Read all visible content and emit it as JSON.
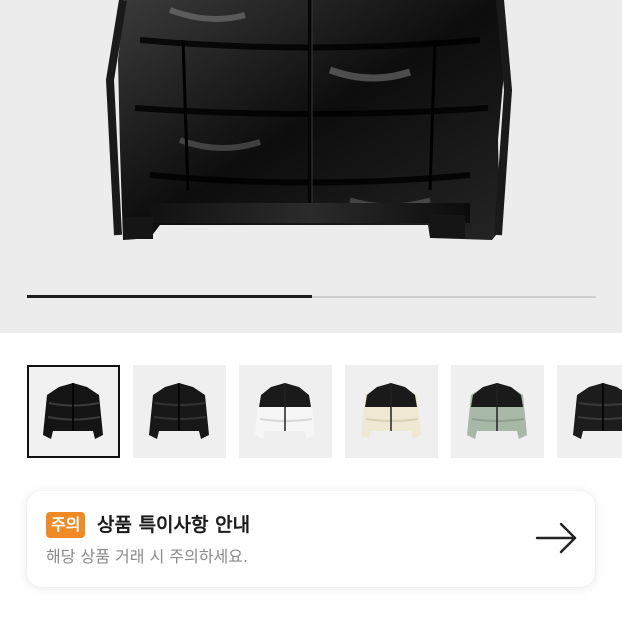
{
  "gallery": {
    "progress_fraction": 0.5,
    "thumbnails": [
      {
        "variant": "glossy-black",
        "selected": true
      },
      {
        "variant": "matte-black",
        "selected": false
      },
      {
        "variant": "white-black",
        "selected": false
      },
      {
        "variant": "cream-black",
        "selected": false
      },
      {
        "variant": "sage-black",
        "selected": false
      },
      {
        "variant": "black",
        "selected": false
      }
    ]
  },
  "notice": {
    "badge": "주의",
    "title": "상품 특이사항 안내",
    "subtitle": "해당 상품 거래 시 주의하세요.",
    "arrow_icon": "arrow-right-icon",
    "badge_color": "#f08a24"
  }
}
